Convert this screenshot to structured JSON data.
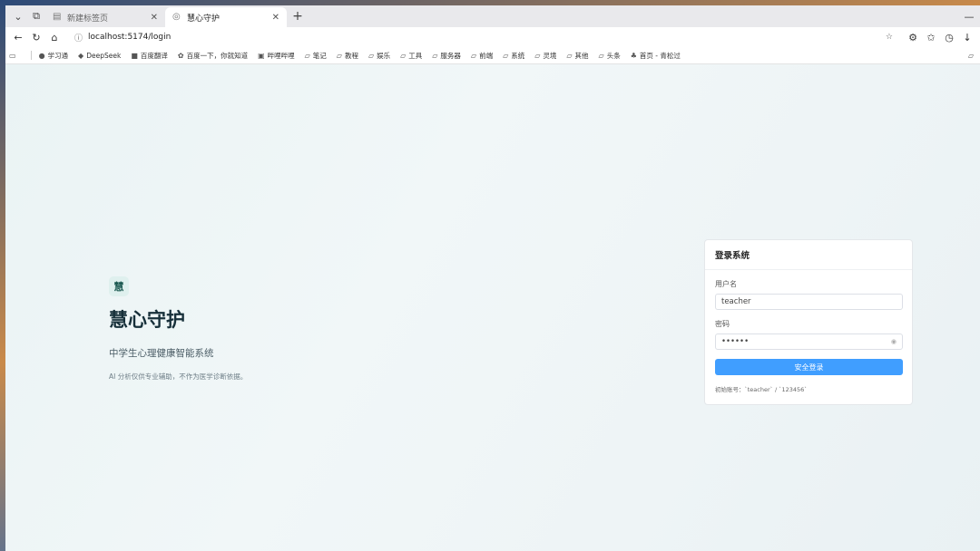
{
  "tabs": [
    {
      "title": "新建标签页",
      "active": false
    },
    {
      "title": "慧心守护",
      "active": true
    }
  ],
  "address": {
    "url": "localhost:5174/login"
  },
  "bookmarks": [
    "学习通",
    "DeepSeek",
    "百度翻译",
    "百度一下，你就知道",
    "哔哩哔哩",
    "笔记",
    "教程",
    "娱乐",
    "工具",
    "服务器",
    "前端",
    "系统",
    "灵境",
    "其他",
    "头条",
    "首页 - 青松过"
  ],
  "hero": {
    "logo_char": "慧",
    "title": "慧心守护",
    "subtitle": "中学生心理健康智能系统",
    "note": "AI 分析仅供专业辅助，不作为医学诊断依据。"
  },
  "login": {
    "header": "登录系统",
    "username_label": "用户名",
    "username_value": "teacher",
    "password_label": "密码",
    "password_value": "••••••",
    "submit_label": "安全登录",
    "hint": "初始账号：`teacher` / `123456`"
  },
  "colors": {
    "primary": "#409eff",
    "title": "#17303a"
  }
}
